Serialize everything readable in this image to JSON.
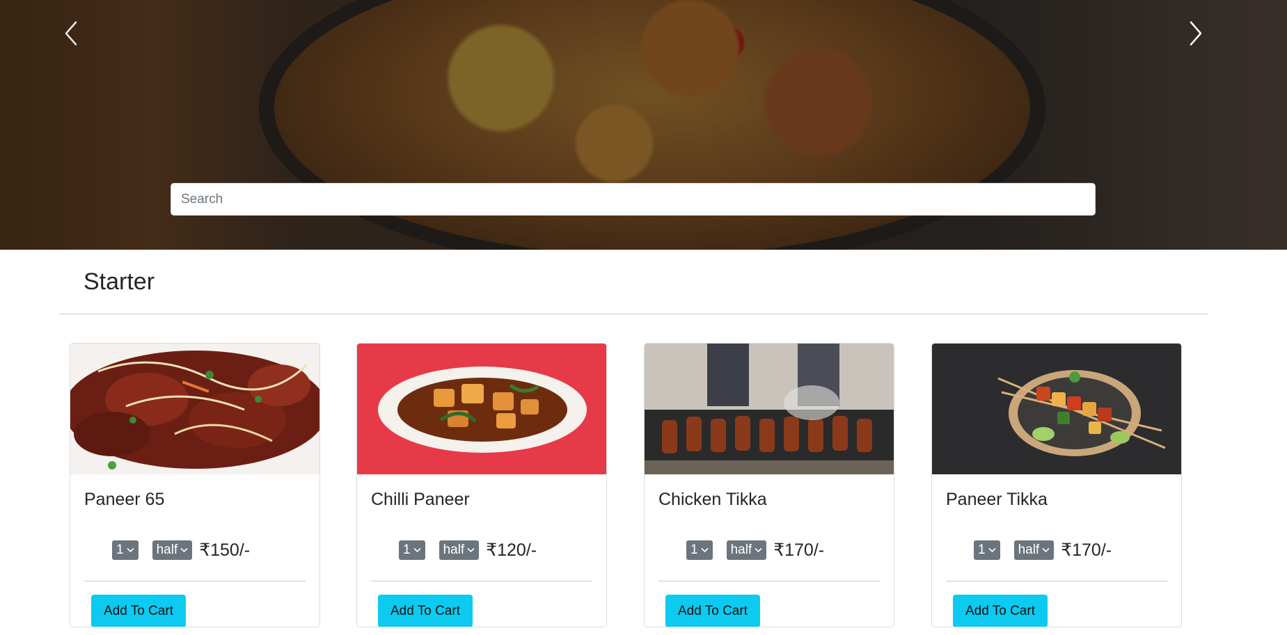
{
  "hero": {
    "prev_icon": "chevron-left-icon",
    "next_icon": "chevron-right-icon",
    "search_placeholder": "Search"
  },
  "section": {
    "title": "Starter"
  },
  "items": [
    {
      "name": "Paneer 65",
      "quantity": "1",
      "portion": "half",
      "price": "₹150/-",
      "button": "Add To Cart"
    },
    {
      "name": "Chilli Paneer",
      "quantity": "1",
      "portion": "half",
      "price": "₹120/-",
      "button": "Add To Cart"
    },
    {
      "name": "Chicken Tikka",
      "quantity": "1",
      "portion": "half",
      "price": "₹170/-",
      "button": "Add To Cart"
    },
    {
      "name": "Paneer Tikka",
      "quantity": "1",
      "portion": "half",
      "price": "₹170/-",
      "button": "Add To Cart"
    }
  ],
  "colors": {
    "accent_button": "#0dcaf0",
    "select_bg": "#6c757d"
  }
}
